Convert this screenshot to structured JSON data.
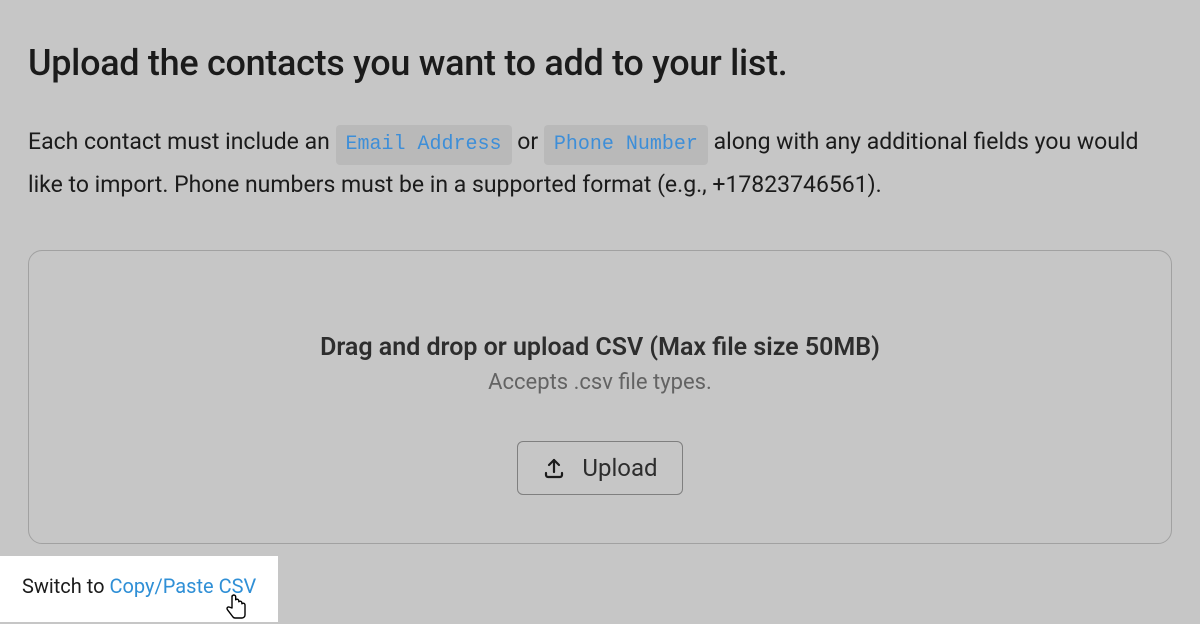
{
  "title": "Upload the contacts you want to add to your list.",
  "description": {
    "part1": "Each contact must include an ",
    "chip_email": "Email Address",
    "between": " or ",
    "chip_phone": "Phone Number",
    "part2": " along with any additional fields you would like to import. Phone numbers must be in a supported format (e.g., +17823746561)."
  },
  "dropzone": {
    "headline": "Drag and drop or upload CSV (Max file size 50MB)",
    "sub": "Accepts .csv file types.",
    "button_label": "Upload"
  },
  "switch": {
    "prefix": "Switch to ",
    "link": "Copy/Paste CSV"
  }
}
